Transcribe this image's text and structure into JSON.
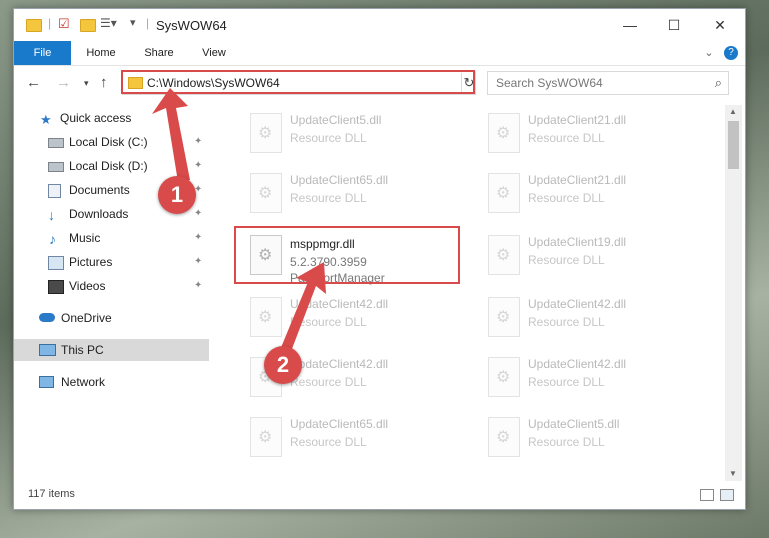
{
  "window": {
    "title": "SysWOW64",
    "controls": {
      "minimize": "—",
      "maximize": "☐",
      "close": "✕"
    }
  },
  "ribbon": {
    "tabs": [
      "File",
      "Home",
      "Share",
      "View"
    ],
    "expand": "⌄",
    "help": "?"
  },
  "nav": {
    "address": "C:\\Windows\\SysWOW64",
    "refresh": "↻",
    "search_placeholder": "Search SysWOW64",
    "search_icon": "⌕"
  },
  "sidebar": {
    "items": [
      {
        "label": "Quick access",
        "icon": "star-icon",
        "pinned": false
      },
      {
        "label": "Local Disk (C:)",
        "icon": "drive-icon",
        "pinned": true
      },
      {
        "label": "Local Disk (D:)",
        "icon": "drive-icon",
        "pinned": true
      },
      {
        "label": "Documents",
        "icon": "documents-icon",
        "pinned": true
      },
      {
        "label": "Downloads",
        "icon": "downloads-icon",
        "pinned": true
      },
      {
        "label": "Music",
        "icon": "music-icon",
        "pinned": true
      },
      {
        "label": "Pictures",
        "icon": "pictures-icon",
        "pinned": true
      },
      {
        "label": "Videos",
        "icon": "videos-icon",
        "pinned": true
      },
      {
        "label": "OneDrive",
        "icon": "cloud-icon",
        "pinned": false
      },
      {
        "label": "This PC",
        "icon": "computer-icon",
        "pinned": false
      },
      {
        "label": "Network",
        "icon": "network-icon",
        "pinned": false
      }
    ],
    "pin_glyph": "📌"
  },
  "files": {
    "left": [
      {
        "name": "UpdateClient5.dll",
        "desc": "Resource DLL"
      },
      {
        "name": "UpdateClient65.dll",
        "desc": "Resource DLL"
      },
      {
        "name": "msppmgr.dll",
        "desc": "5.2.3790.3959",
        "desc2": "PassportManager"
      },
      {
        "name": "UpdateClient42.dll",
        "desc": "Resource DLL"
      },
      {
        "name": "UpdateClient42.dll",
        "desc": "Resource DLL"
      },
      {
        "name": "UpdateClient65.dll",
        "desc": "Resource DLL"
      }
    ],
    "right": [
      {
        "name": "UpdateClient21.dll",
        "desc": "Resource DLL"
      },
      {
        "name": "UpdateClient21.dll",
        "desc": "Resource DLL"
      },
      {
        "name": "UpdateClient19.dll",
        "desc": "Resource DLL"
      },
      {
        "name": "UpdateClient42.dll",
        "desc": "Resource DLL"
      },
      {
        "name": "UpdateClient42.dll",
        "desc": "Resource DLL"
      },
      {
        "name": "UpdateClient5.dll",
        "desc": "Resource DLL"
      }
    ]
  },
  "status": {
    "count": "117 items"
  },
  "annotations": {
    "marker1": "1",
    "marker2": "2",
    "color": "#d94a4a"
  }
}
